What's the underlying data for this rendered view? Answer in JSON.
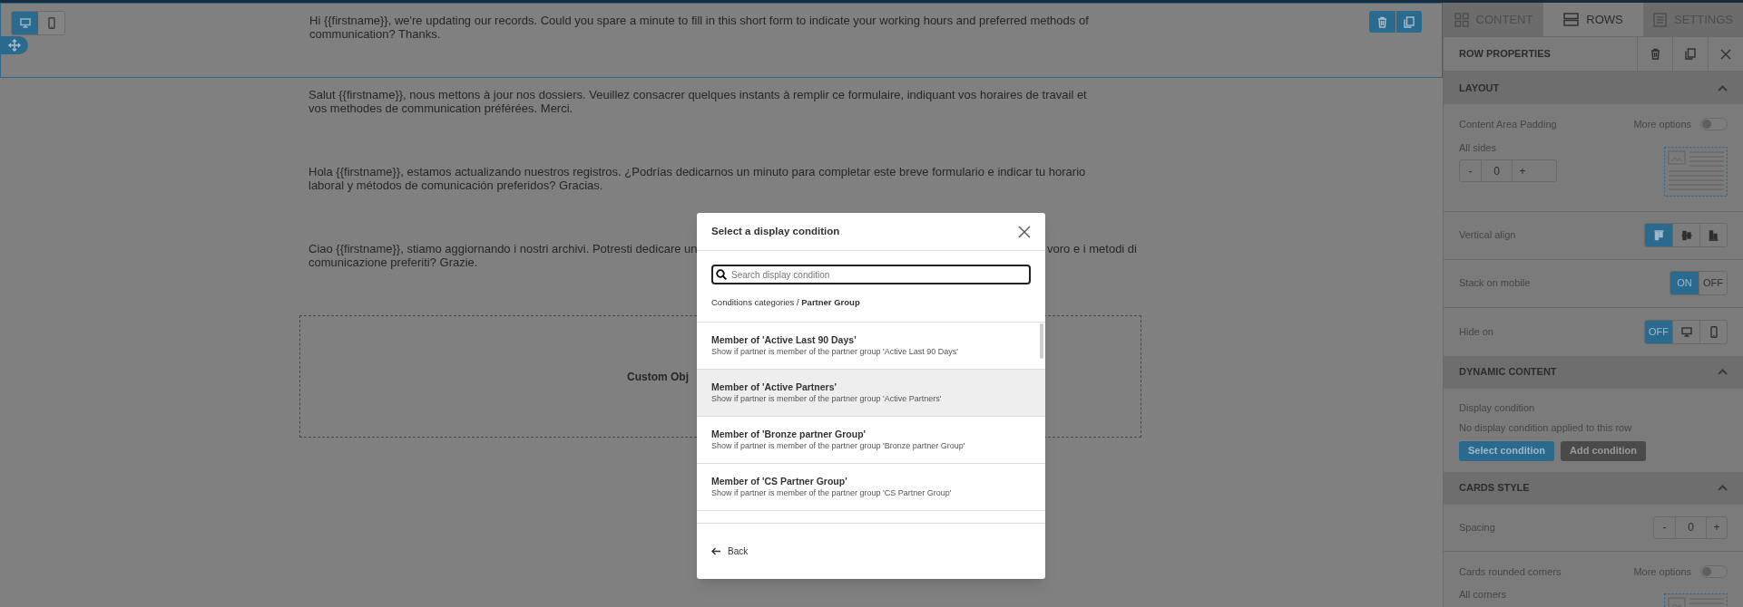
{
  "editor": {
    "view_toggle": [
      {
        "kind": "desktop",
        "selected": true
      },
      {
        "kind": "mobile",
        "selected": false
      }
    ],
    "paragraphs": [
      {
        "kind": "plain",
        "text": "Hi {{firstname}}, we're updating our records. Could you spare a minute to fill in this short form to indicate your working hours and preferred methods of communication? Thanks."
      },
      {
        "kind": "plain",
        "text": "Salut {{firstname}}, nous mettons à jour nos dossiers. Veuillez consacrer quelques instants à remplir ce formulaire, indiquant vos horaires de travail et vos methodes de communication préférées. Merci."
      },
      {
        "kind": "plain",
        "text": "Hola {{firstname}}, estamos actualizando nuestros registros. ¿Podrías dedicarnos un minuto para completar este breve formulario e indicar tu horario laboral y métodos de comunicación preferidos? Gracias."
      },
      {
        "kind": "covered",
        "left": "Ciao {{firstname}}, stiamo aggiornando i nostri archivi. Potresti dedicare un",
        "right": "voro e i metodi di",
        "rest": "comunicazione preferiti? Grazie."
      }
    ],
    "custom_block": {
      "label": "Custom Obj"
    }
  },
  "panel": {
    "tabs": [
      {
        "kind": "content",
        "label": "CONTENT",
        "selected": false
      },
      {
        "kind": "rows",
        "label": "ROWS",
        "selected": true
      },
      {
        "kind": "settings",
        "label": "SETTINGS",
        "selected": false
      }
    ],
    "title": "ROW PROPERTIES",
    "sections": [
      {
        "title": "LAYOUT",
        "expanded": true,
        "items": [
          {
            "kind": "padding",
            "label": "Content Area Padding",
            "more_label": "More options",
            "more_on": false,
            "sub_label": "All sides",
            "minus": "-",
            "value": "0",
            "plus": "+"
          },
          {
            "kind": "align",
            "label": "Vertical align",
            "options": [
              {
                "kind": "top",
                "selected": true
              },
              {
                "kind": "middle",
                "selected": false
              },
              {
                "kind": "bottom",
                "selected": false
              }
            ]
          },
          {
            "kind": "switch",
            "label": "Stack on mobile",
            "options": [
              {
                "label": "ON",
                "selected": true
              },
              {
                "label": "OFF",
                "selected": false
              }
            ]
          },
          {
            "kind": "hide",
            "label": "Hide on",
            "options": [
              {
                "label": "OFF",
                "selected": true
              },
              {
                "kind": "desktop",
                "selected": false
              },
              {
                "kind": "mobile",
                "selected": false
              }
            ]
          }
        ]
      },
      {
        "title": "DYNAMIC CONTENT",
        "expanded": true,
        "items": [
          {
            "kind": "condition",
            "label": "Display condition",
            "note": "No display condition applied to this row",
            "buttons": [
              {
                "kind": "primary",
                "label": "Select condition"
              },
              {
                "kind": "secondary",
                "label": "Add condition"
              }
            ]
          }
        ]
      },
      {
        "title": "CARDS STYLE",
        "expanded": true,
        "items": [
          {
            "kind": "stepper",
            "label": "Spacing",
            "minus": "-",
            "value": "0",
            "plus": "+"
          },
          {
            "kind": "padding",
            "label": "Cards rounded corners",
            "more_label": "More options",
            "more_on": false,
            "sub_label": "All corners"
          }
        ]
      }
    ]
  },
  "modal": {
    "title": "Select a display condition",
    "search": {
      "placeholder": "Search display condition"
    },
    "breadcrumb": "Conditions categories / **Partner Group**",
    "items": [
      {
        "title": "Member of 'Active Last 90 Days'",
        "description": "Show if partner is member of the partner group 'Active Last 90 Days'",
        "highlighted": false
      },
      {
        "title": "Member of 'Active Partners'",
        "description": "Show if partner is member of the partner group 'Active Partners'",
        "highlighted": true
      },
      {
        "title": "Member of 'Bronze partner Group'",
        "description": "Show if partner is member of the partner group 'Bronze partner Group'",
        "highlighted": false
      },
      {
        "title": "Member of 'CS Partner Group'",
        "description": "Show if partner is member of the partner group 'CS Partner Group'",
        "highlighted": false
      }
    ],
    "back": "Back"
  }
}
